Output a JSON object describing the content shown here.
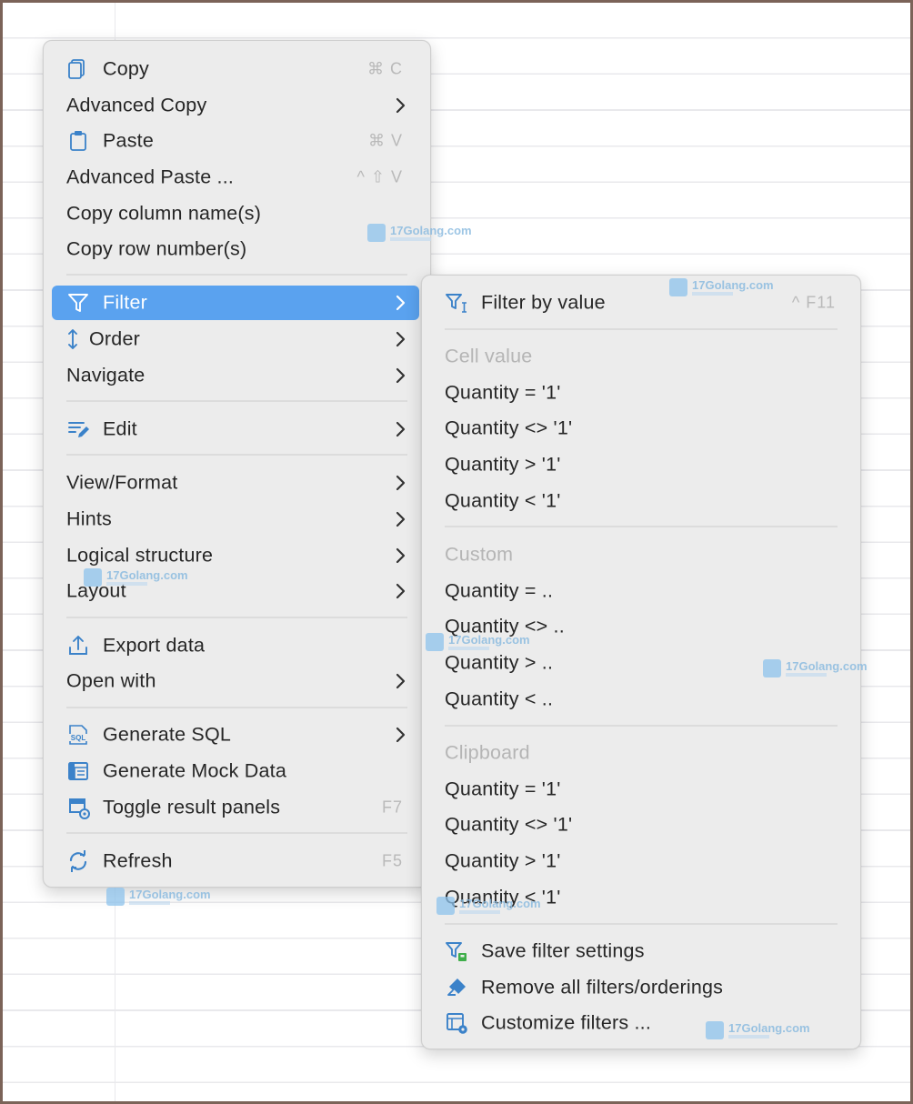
{
  "main_menu": {
    "items": [
      {
        "label": "Copy",
        "shortcut": "⌘ C",
        "icon": "copy-icon"
      },
      {
        "label": "Advanced Copy",
        "submenu": true
      },
      {
        "label": "Paste",
        "shortcut": "⌘ V",
        "icon": "clipboard-icon"
      },
      {
        "label": "Advanced Paste ...",
        "shortcut": "^ ⇧ V"
      },
      {
        "label": "Copy column name(s)"
      },
      {
        "label": "Copy row number(s)"
      },
      {
        "label": "Filter",
        "icon": "filter-icon",
        "submenu": true,
        "selected": true
      },
      {
        "label": "Order",
        "icon": "sort-arrows-icon",
        "submenu": true
      },
      {
        "label": "Navigate",
        "submenu": true
      },
      {
        "label": "Edit",
        "icon": "edit-icon",
        "submenu": true
      },
      {
        "label": "View/Format",
        "submenu": true
      },
      {
        "label": "Hints",
        "submenu": true
      },
      {
        "label": "Logical structure",
        "submenu": true
      },
      {
        "label": "Layout",
        "submenu": true
      },
      {
        "label": "Export data",
        "icon": "export-icon"
      },
      {
        "label": "Open with",
        "submenu": true
      },
      {
        "label": "Generate SQL",
        "icon": "sql-icon",
        "submenu": true
      },
      {
        "label": "Generate Mock Data",
        "icon": "mock-data-icon"
      },
      {
        "label": "Toggle result panels",
        "shortcut": "F7",
        "icon": "result-panels-icon"
      },
      {
        "label": "Refresh",
        "shortcut": "F5",
        "icon": "refresh-icon"
      }
    ]
  },
  "filter_submenu": {
    "items": [
      {
        "label": "Filter by value",
        "shortcut": "^ F11",
        "icon": "filter-value-icon"
      },
      {
        "label": "Cell value",
        "header": true
      },
      {
        "label": "Quantity = '1'"
      },
      {
        "label": "Quantity <> '1'"
      },
      {
        "label": "Quantity > '1'"
      },
      {
        "label": "Quantity < '1'"
      },
      {
        "label": "Custom",
        "header": true
      },
      {
        "label": "Quantity = .."
      },
      {
        "label": "Quantity <> .."
      },
      {
        "label": "Quantity > .."
      },
      {
        "label": "Quantity < .."
      },
      {
        "label": "Clipboard",
        "header": true
      },
      {
        "label": "Quantity = '1'"
      },
      {
        "label": "Quantity <> '1'"
      },
      {
        "label": "Quantity > '1'"
      },
      {
        "label": "Quantity < '1'"
      },
      {
        "label": "Save filter settings",
        "icon": "save-filter-icon"
      },
      {
        "label": "Remove all filters/orderings",
        "icon": "eraser-icon"
      },
      {
        "label": "Customize filters ...",
        "icon": "customize-filters-icon"
      }
    ]
  },
  "watermark": {
    "text": "17Golang.com"
  },
  "colors": {
    "accent": "#5aa2ef",
    "icon_blue": "#3b82c9",
    "menu_bg": "#ececec"
  }
}
